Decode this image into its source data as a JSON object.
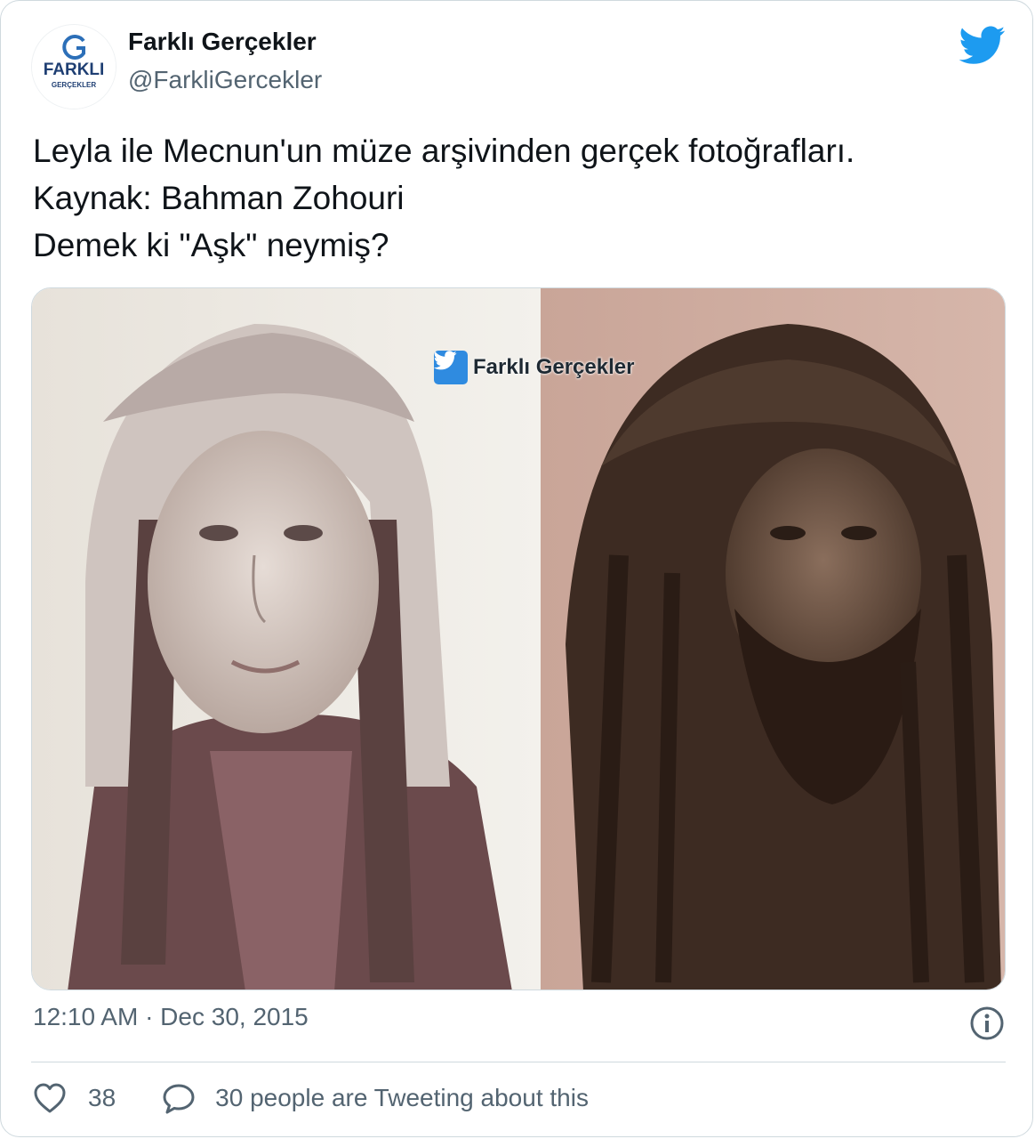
{
  "tweet": {
    "author": {
      "display_name": "Farklı Gerçekler",
      "handle": "@FarkliGercekler",
      "avatar_logo_text": "FARKLI",
      "avatar_logo_subtext": "GERÇEKLER"
    },
    "text_lines": [
      "Leyla ile Mecnun'un müze arşivinden gerçek fotoğrafları.",
      "Kaynak: Bahman Zohouri",
      "Demek ki \"Aşk\" neymiş?"
    ],
    "media": {
      "watermark": "Farklı Gerçekler"
    },
    "timestamp": "12:10 AM · Dec 30, 2015",
    "likes": "38",
    "tweeting_about": "30 people are Tweeting about this"
  },
  "icons": {
    "brand": "twitter-bird-icon",
    "info": "info-icon",
    "like": "heart-icon",
    "reply": "speech-bubble-icon"
  },
  "colors": {
    "twitter_blue": "#1d9bf0",
    "text_primary": "#0f1419",
    "text_secondary": "#536471",
    "border": "#cfd9de"
  }
}
